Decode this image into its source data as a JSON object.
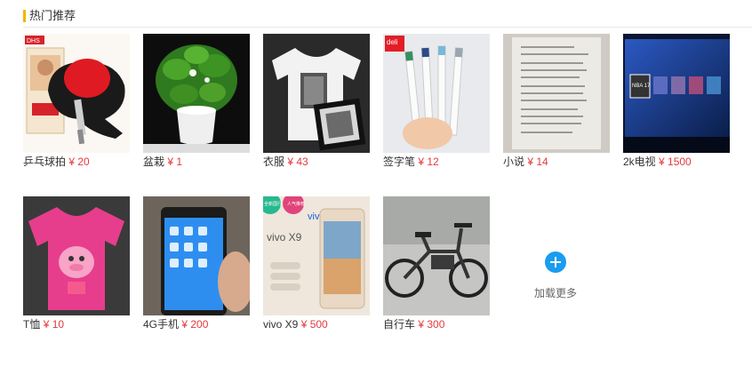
{
  "section": {
    "title": "热门推荐"
  },
  "items": [
    {
      "name": "乒乓球拍",
      "price": "¥ 20",
      "icon": "ping-pong-paddle-image"
    },
    {
      "name": "盆栽",
      "price": "¥ 1",
      "icon": "potted-plant-image"
    },
    {
      "name": "衣服",
      "price": "¥ 43",
      "icon": "tshirt-image"
    },
    {
      "name": "签字笔",
      "price": "¥ 12",
      "icon": "pens-image"
    },
    {
      "name": "小说",
      "price": "¥ 14",
      "icon": "paper-document-image"
    },
    {
      "name": "2k电视",
      "price": "¥ 1500",
      "icon": "tv-screen-image"
    },
    {
      "name": "T恤",
      "price": "¥ 10",
      "icon": "pink-tshirt-image"
    },
    {
      "name": "4G手机",
      "price": "¥ 200",
      "icon": "smartphone-image"
    },
    {
      "name": "vivo X9",
      "price": "¥ 500",
      "icon": "vivo-phone-ad-image"
    },
    {
      "name": "自行车",
      "price": "¥ 300",
      "icon": "electric-bike-image"
    }
  ],
  "thumb_text": {
    "dhs_logo": "DHS",
    "deli_logo": "deli",
    "nba_tile": "NBA 17",
    "vivo_brand": "vivo",
    "vivo_model": "vivo X9",
    "vivo_badge1": "全新国行",
    "vivo_badge2": "人气推荐"
  },
  "load_more": {
    "label": "加载更多",
    "icon": "plus-circle-icon"
  }
}
